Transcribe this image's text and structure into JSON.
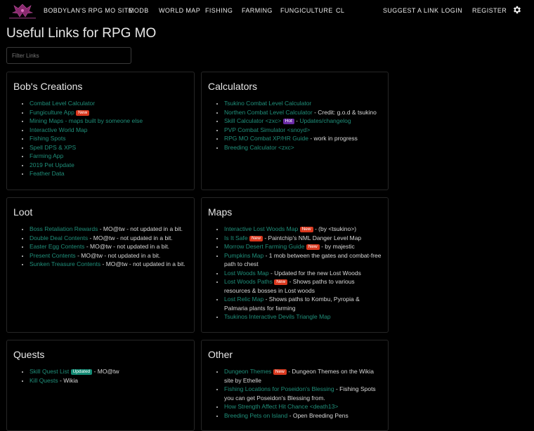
{
  "nav": {
    "links": [
      "BOBDYLAN'S RPG MO SITE",
      "MODB",
      "WORLD MAP",
      "FISHING",
      "FARMING",
      "FUNGICULTURE",
      "CL"
    ],
    "right_links": [
      "SUGGEST A LINK",
      "LOGIN",
      "REGISTER"
    ],
    "settings_icon": "gear-icon",
    "logo_icon": "rpgmo-logo-icon"
  },
  "page": {
    "title": "Useful Links for RPG MO",
    "filter_placeholder": "Filter Links"
  },
  "colors": {
    "link": "#1f8f7a",
    "badge_new": "#d9381e",
    "badge_hot": "#6a2aa6",
    "badge_updated": "#138a74"
  },
  "sections": {
    "bobs": {
      "title": "Bob's Creations",
      "items": [
        {
          "link": "Combat Level Calculator"
        },
        {
          "link": "Fungiculture App",
          "badge": "New"
        },
        {
          "link": "Mining Maps",
          "text": "- maps built by someone else"
        },
        {
          "link": "Interactive World Map"
        },
        {
          "link": "Fishing Spots"
        },
        {
          "link": "Spell DPS & XPS"
        },
        {
          "link": "Farming App"
        },
        {
          "link": "2019 Pet Update"
        },
        {
          "link": "Feather Data"
        }
      ]
    },
    "calculators": {
      "title": "Calculators",
      "items": [
        {
          "link": "Tsukino Combat Level Calculator"
        },
        {
          "link": "Northen Combat Level Calculator",
          "text": "- Credit: g.o.d & tsukino"
        },
        {
          "link": "Skill Calculator <zxc>",
          "badge": "Hot",
          "link2": "Updates/changelog"
        },
        {
          "link": "PVP Combat Simulator <snoyd>"
        },
        {
          "link": "RPG MO Combat XP/HR Guide",
          "text": "- work in progress"
        },
        {
          "link": "Breeding Calculator <zxc>"
        }
      ]
    },
    "loot": {
      "title": "Loot",
      "items": [
        {
          "link": "Boss Retaliation Rewards",
          "text": "- MO@tw - not updated in a bit."
        },
        {
          "link": "Double Deal Contents",
          "text": "- MO@tw - not updated in a bit."
        },
        {
          "link": "Easter Egg Contents",
          "text": "- MO@tw - not updated in a bit."
        },
        {
          "link": "Present Contents",
          "text": "- MO@tw - not updated in a bit."
        },
        {
          "link": "Sunken Treasure Contents",
          "text": "- MO@tw - not updated in a bit."
        }
      ]
    },
    "maps": {
      "title": "Maps",
      "items": [
        {
          "link": "Interactive Lost Woods Map",
          "badge": "New",
          "text": "- (by <tsukino>)"
        },
        {
          "link": "Is It Safe",
          "badge": "New",
          "text": "- Paintchip's NML Danger Level Map"
        },
        {
          "link": "Morrow Desert Farming Guide",
          "badge": "New",
          "text": "- by majestic"
        },
        {
          "link": "Pumpkins Map",
          "text": "- 1 mob between the gates and combat-free path to chest"
        },
        {
          "link": "Lost Woods Map",
          "text": "- Updated for the new Lost Woods"
        },
        {
          "link": "Lost Woods Paths",
          "badge": "New",
          "text": "- Shows paths to various resources & bosses in Lost woods"
        },
        {
          "link": "Lost Relic Map",
          "text": "- Shows paths to Kombu, Pyropia & Palmaria plants for farming"
        },
        {
          "link": "Tsukinos Interactive Devils Triangle Map"
        }
      ]
    },
    "quests": {
      "title": "Quests",
      "items": [
        {
          "link": "Skill Quest List",
          "badge": "Updated",
          "text": "- MO@tw"
        },
        {
          "link": "Kill Quests",
          "text": "- Wikia"
        }
      ]
    },
    "other": {
      "title": "Other",
      "items": [
        {
          "link": "Dungeon Themes",
          "badge": "New",
          "text": "- Dungeon Themes on the Wikia site by Ethelle"
        },
        {
          "link": "Fishing Locations for Poseidon's Blessing",
          "text": "- Fishing Spots you can get Poseidon's Blessing from."
        },
        {
          "link": "How Strength Affect Hit Chance <death13>"
        },
        {
          "link": "Breeding Pets on Island",
          "text": "- Open Breeding Pens"
        }
      ]
    }
  }
}
